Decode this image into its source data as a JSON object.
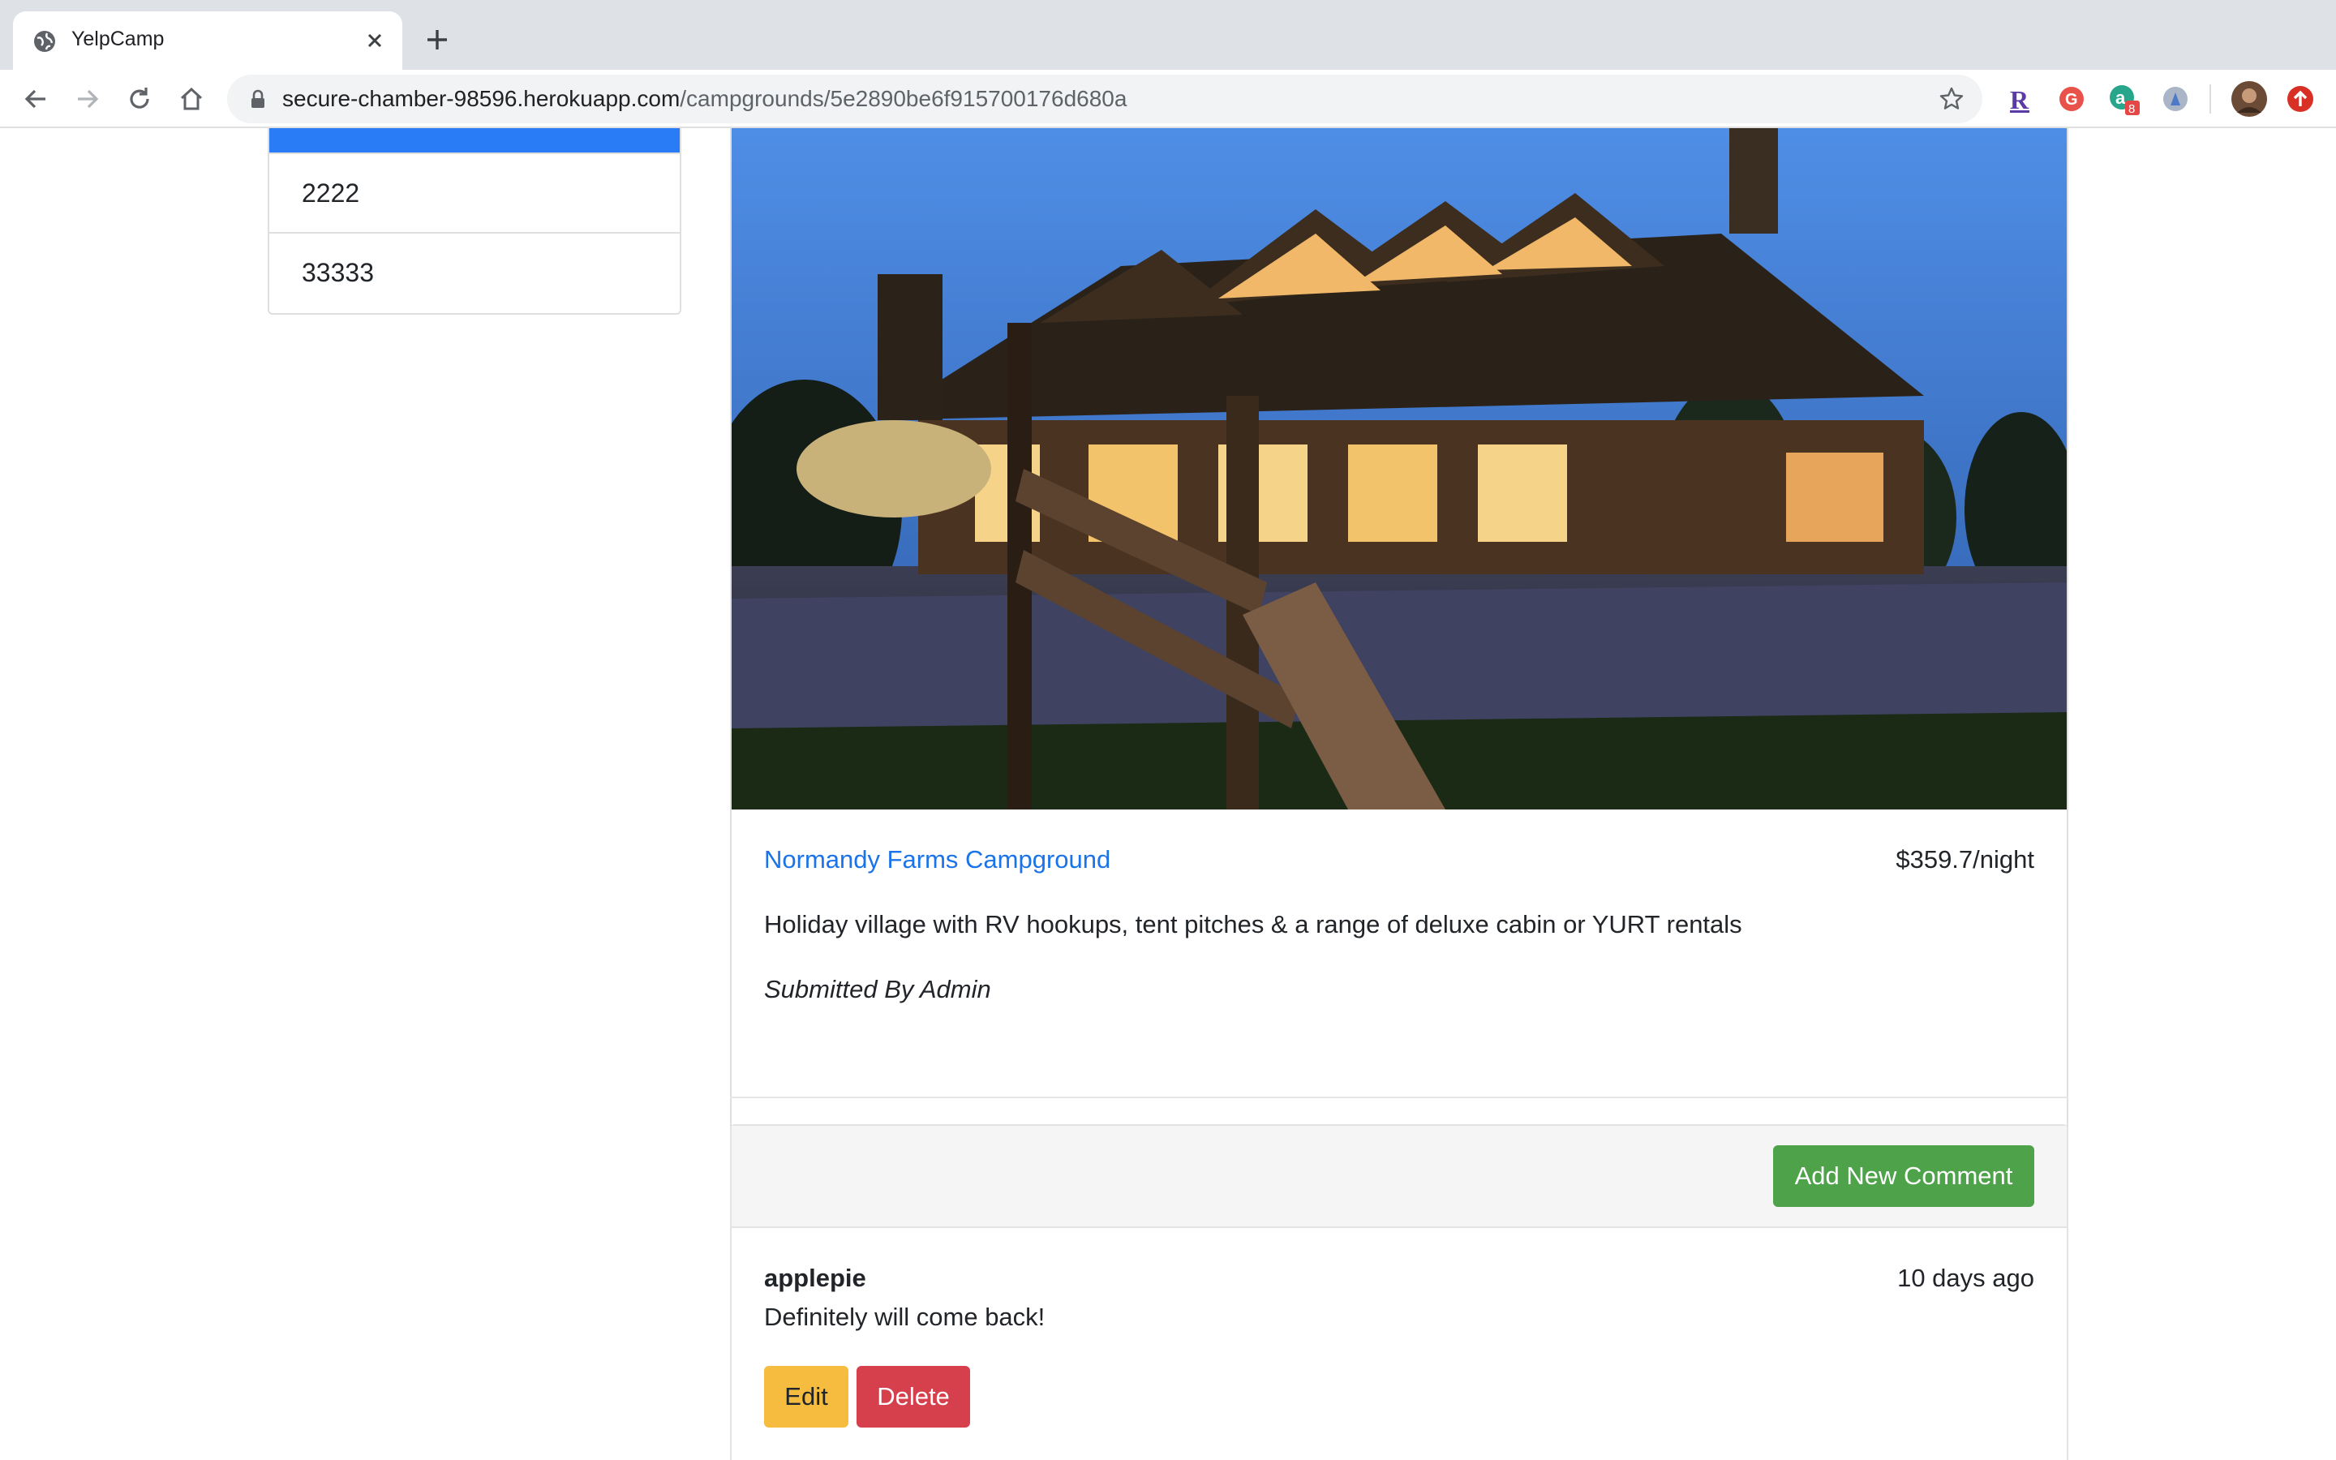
{
  "browser": {
    "tab_title": "YelpCamp",
    "url_host": "secure-chamber-98596.herokuapp.com",
    "url_path": "/campgrounds/5e2890be6f915700176d680a",
    "extension_badge": "8"
  },
  "sidebar": {
    "items": [
      {
        "label": ""
      },
      {
        "label": "2222"
      },
      {
        "label": "33333"
      }
    ]
  },
  "campground": {
    "name": "Normandy Farms Campground",
    "price": "$359.7/night",
    "description": "Holiday village with RV hookups, tent pitches & a range of deluxe cabin or YURT rentals",
    "author": "Submitted By Admin"
  },
  "comments": {
    "add_label": "Add New Comment",
    "items": [
      {
        "author": "applepie",
        "time": "10 days ago",
        "text": "Definitely will come back!",
        "edit_label": "Edit",
        "delete_label": "Delete"
      }
    ]
  },
  "colors": {
    "primary": "#2a7cf6",
    "link": "#1a73e8",
    "success": "#4ea24a",
    "warning": "#f5bc3f",
    "danger": "#d6404d"
  }
}
